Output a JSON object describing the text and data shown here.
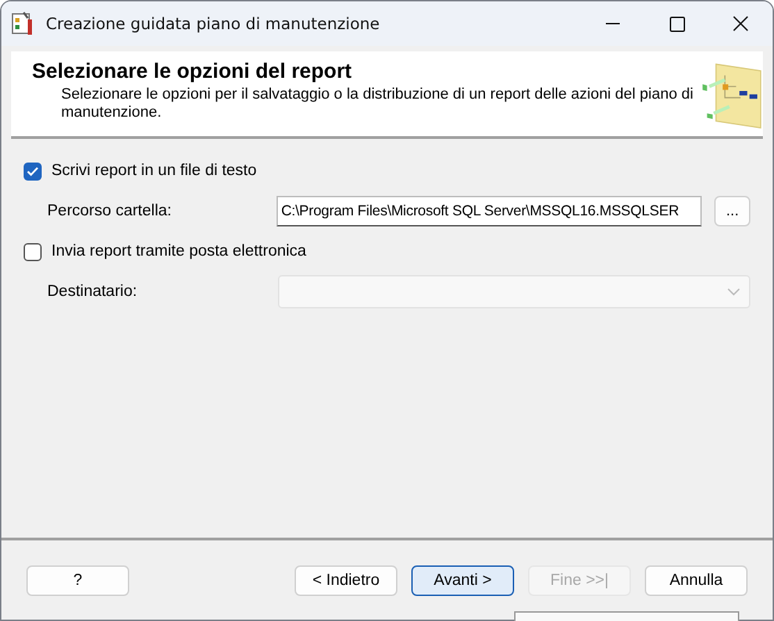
{
  "window": {
    "title": "Creazione guidata piano di manutenzione"
  },
  "header": {
    "title": "Selezionare le opzioni del report",
    "description": "Selezionare le opzioni per il salvataggio o la distribuzione di un report delle azioni del piano di manutenzione."
  },
  "options": [
    {
      "kind": "checkbox",
      "label": "Scrivi report in un file di testo",
      "checked": true
    },
    {
      "kind": "path",
      "label": "Percorso cartella:",
      "value": "C:\\Program Files\\Microsoft SQL Server\\MSSQL16.MSSQLSER",
      "button": "...",
      "disabled": false
    },
    {
      "kind": "checkbox",
      "label": "Invia report tramite posta elettronica",
      "checked": false
    },
    {
      "kind": "dropdown",
      "label": "Destinatario:",
      "disabled": true
    }
  ],
  "buttons": [
    {
      "label": "?",
      "disabled": false,
      "default": false
    },
    {
      "label": "< Indietro",
      "disabled": false,
      "default": false
    },
    {
      "label": "Avanti >",
      "disabled": false,
      "default": true
    },
    {
      "label": "Fine >>|",
      "disabled": true,
      "default": false
    },
    {
      "label": "Annulla",
      "disabled": false,
      "default": false
    }
  ]
}
